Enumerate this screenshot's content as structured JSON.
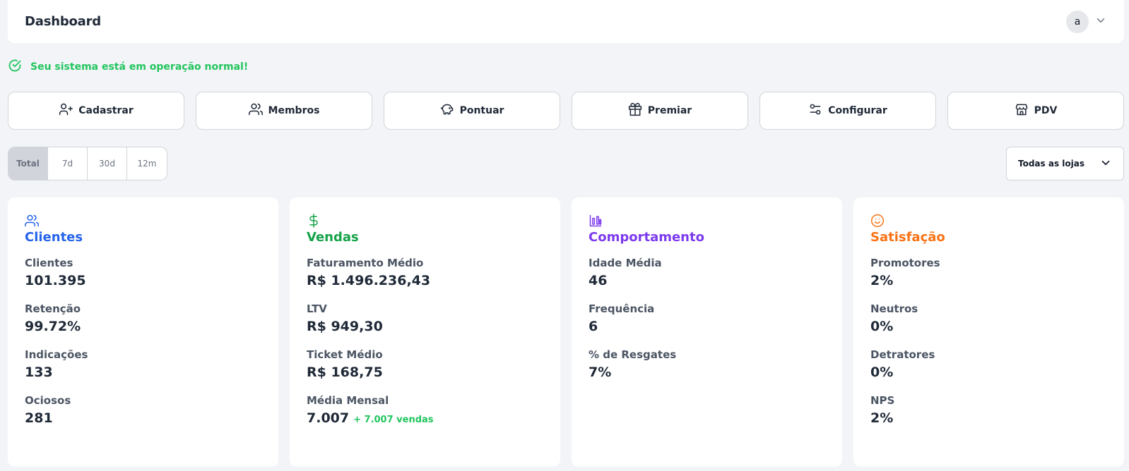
{
  "header": {
    "title": "Dashboard",
    "avatar_initial": "a"
  },
  "status": {
    "text": "Seu sistema está em operação normal!",
    "color": "#22c55e"
  },
  "actions": [
    {
      "label": "Cadastrar",
      "icon": "user-plus-icon"
    },
    {
      "label": "Membros",
      "icon": "users-icon"
    },
    {
      "label": "Pontuar",
      "icon": "piggy-bank-icon"
    },
    {
      "label": "Premiar",
      "icon": "gift-icon"
    },
    {
      "label": "Configurar",
      "icon": "sliders-icon"
    },
    {
      "label": "PDV",
      "icon": "store-icon"
    }
  ],
  "period_filter": {
    "options": [
      "Total",
      "7d",
      "30d",
      "12m"
    ],
    "selected": "Total"
  },
  "store_select": {
    "value": "Todas as lojas"
  },
  "cards": [
    {
      "title": "Clientes",
      "icon": "users-icon",
      "color": "#2563eb",
      "metrics": [
        {
          "label": "Clientes",
          "value": "101.395"
        },
        {
          "label": "Retenção",
          "value": "99.72%"
        },
        {
          "label": "Indicações",
          "value": "133"
        },
        {
          "label": "Ociosos",
          "value": "281"
        }
      ]
    },
    {
      "title": "Vendas",
      "icon": "dollar-icon",
      "color": "#16a34a",
      "metrics": [
        {
          "label": "Faturamento Médio",
          "value": "R$ 1.496.236,43"
        },
        {
          "label": "LTV",
          "value": "R$ 949,30"
        },
        {
          "label": "Ticket Médio",
          "value": "R$ 168,75"
        },
        {
          "label": "Média Mensal",
          "value": "7.007",
          "extra": "+ 7.007 vendas"
        }
      ]
    },
    {
      "title": "Comportamento",
      "icon": "bar-chart-icon",
      "color": "#7c3aed",
      "metrics": [
        {
          "label": "Idade Média",
          "value": "46"
        },
        {
          "label": "Frequência",
          "value": "6"
        },
        {
          "label": "% de Resgates",
          "value": "7%"
        }
      ]
    },
    {
      "title": "Satisfação",
      "icon": "smile-icon",
      "color": "#f97316",
      "metrics": [
        {
          "label": "Promotores",
          "value": "2%"
        },
        {
          "label": "Neutros",
          "value": "0%"
        },
        {
          "label": "Detratores",
          "value": "0%"
        },
        {
          "label": "NPS",
          "value": "2%"
        }
      ]
    }
  ]
}
